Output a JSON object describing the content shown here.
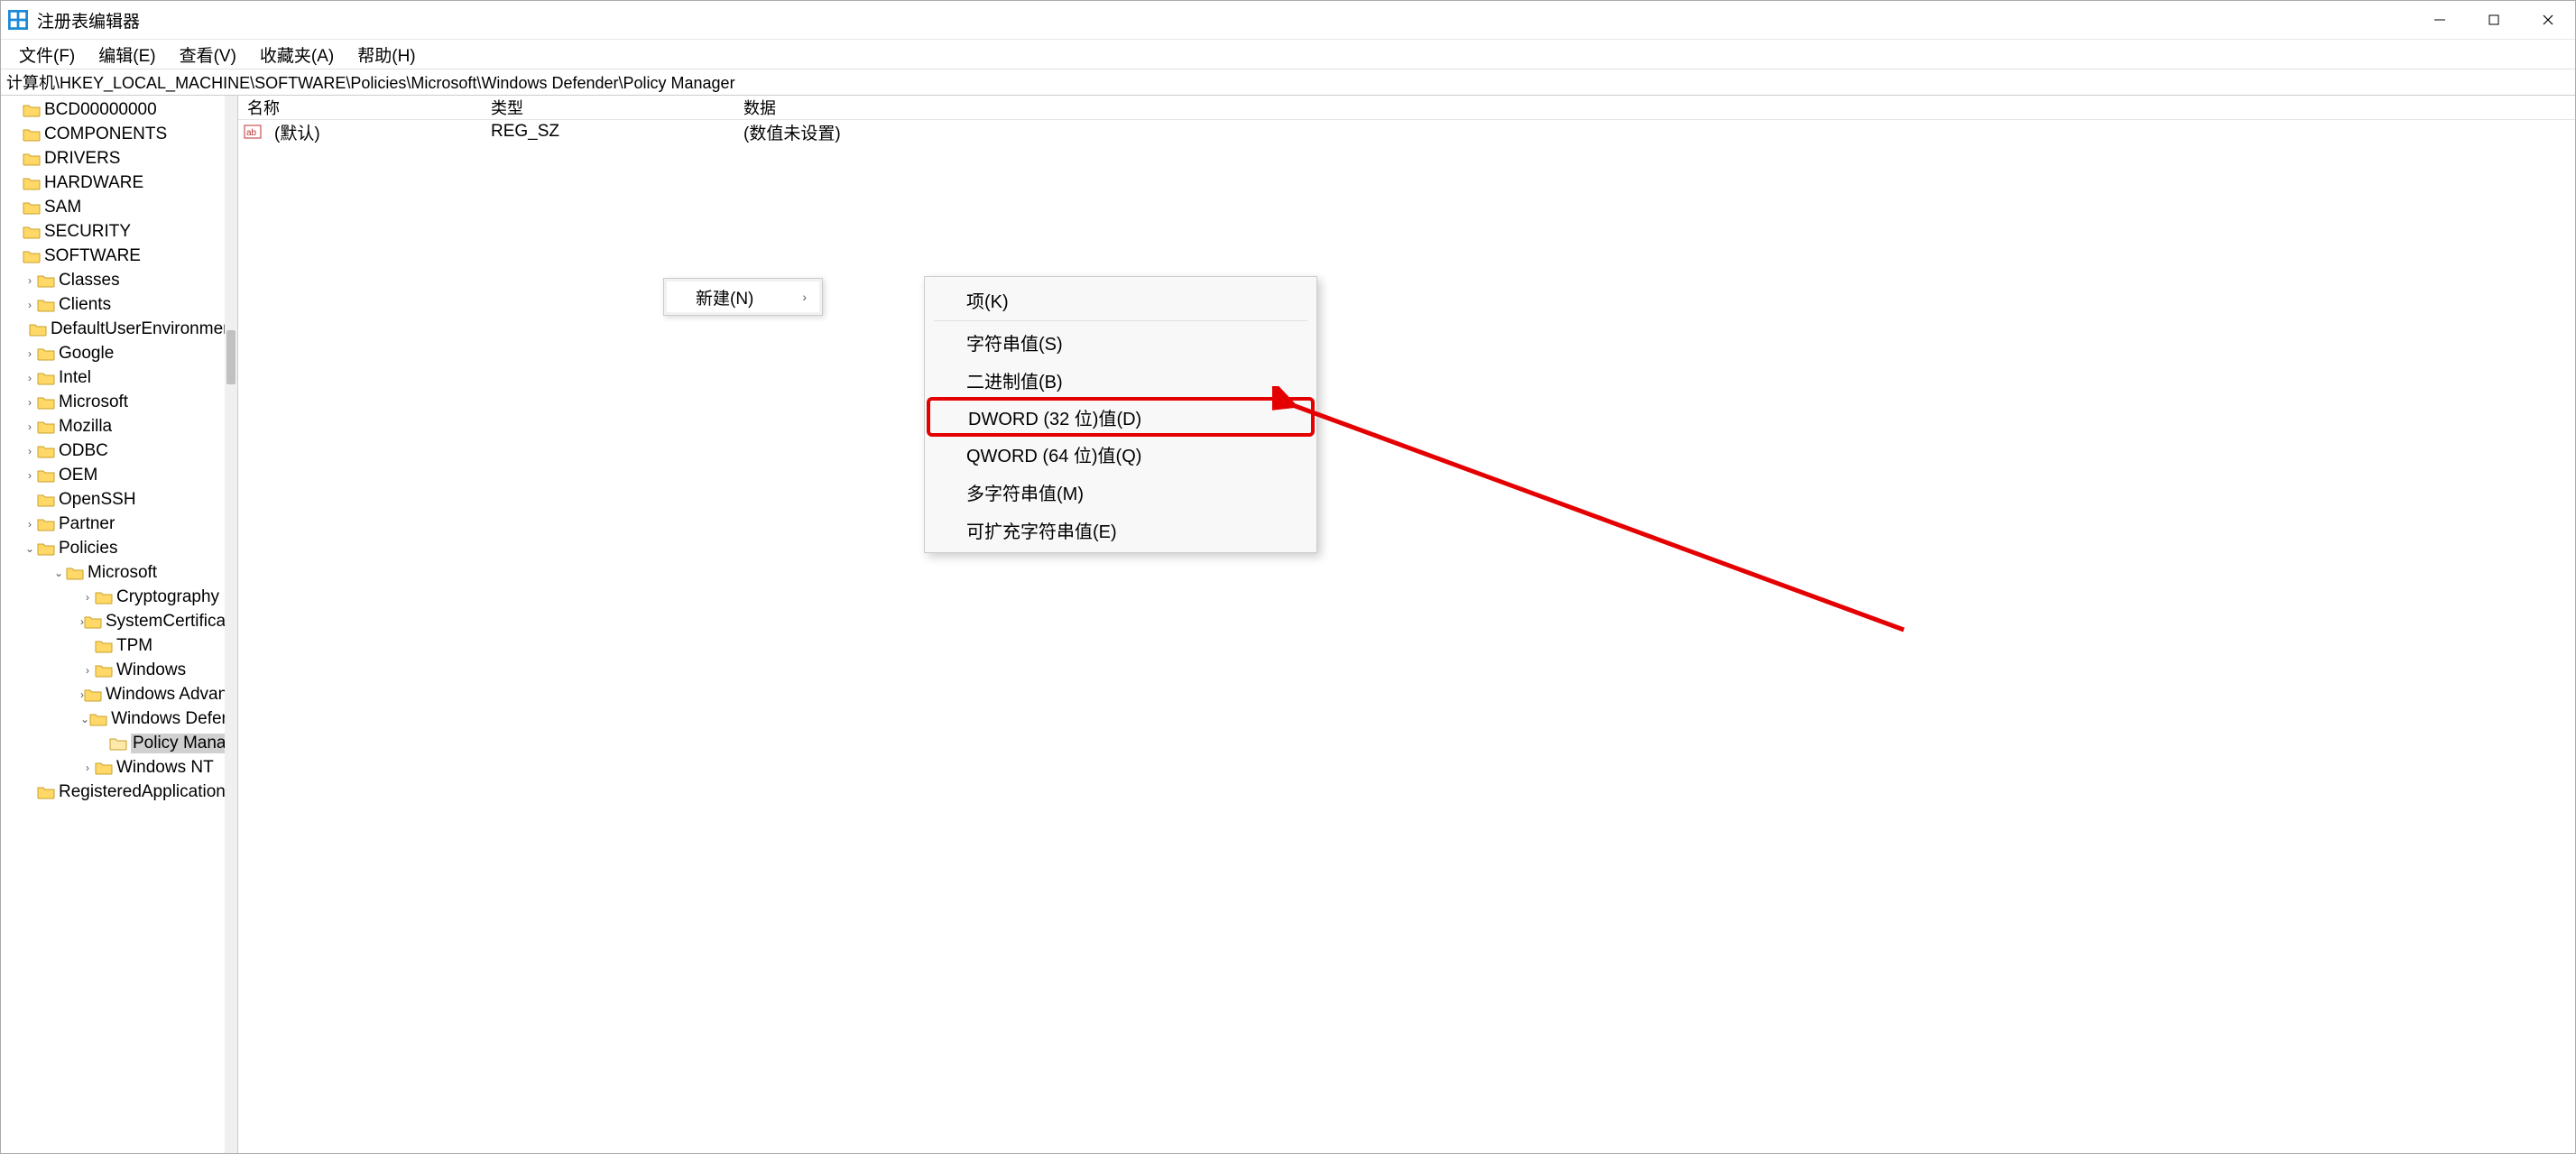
{
  "window": {
    "title": "注册表编辑器"
  },
  "menubar": {
    "file": "文件(F)",
    "edit": "编辑(E)",
    "view": "查看(V)",
    "fav": "收藏夹(A)",
    "help": "帮助(H)"
  },
  "addressbar": "计算机\\HKEY_LOCAL_MACHINE\\SOFTWARE\\Policies\\Microsoft\\Windows Defender\\Policy Manager",
  "tree": {
    "bcd": "BCD00000000",
    "components": "COMPONENTS",
    "drivers": "DRIVERS",
    "hardware": "HARDWARE",
    "sam": "SAM",
    "security": "SECURITY",
    "software": "SOFTWARE",
    "classes": "Classes",
    "clients": "Clients",
    "due": "DefaultUserEnvironment",
    "google": "Google",
    "intel": "Intel",
    "microsoft": "Microsoft",
    "mozilla": "Mozilla",
    "odbc": "ODBC",
    "oem": "OEM",
    "openssh": "OpenSSH",
    "partner": "Partner",
    "policies": "Policies",
    "ms": "Microsoft",
    "crypto": "Cryptography",
    "syscerts": "SystemCertificates",
    "tpm": "TPM",
    "windows": "Windows",
    "winadvth": "Windows Advanced Th",
    "windef": "Windows Defender",
    "policymgr": "Policy Manager",
    "winnt": "Windows NT",
    "regapps": "RegisteredApplications"
  },
  "list": {
    "col_name": "名称",
    "col_type": "类型",
    "col_data": "数据",
    "row_default_name": "(默认)",
    "row_default_type": "REG_SZ",
    "row_default_data": "(数值未设置)"
  },
  "submenu_new_label": "新建(N)",
  "context_menu": {
    "key": "项(K)",
    "string": "字符串值(S)",
    "binary": "二进制值(B)",
    "dword": "DWORD (32 位)值(D)",
    "qword": "QWORD (64 位)值(Q)",
    "multi": "多字符串值(M)",
    "expand": "可扩充字符串值(E)"
  }
}
